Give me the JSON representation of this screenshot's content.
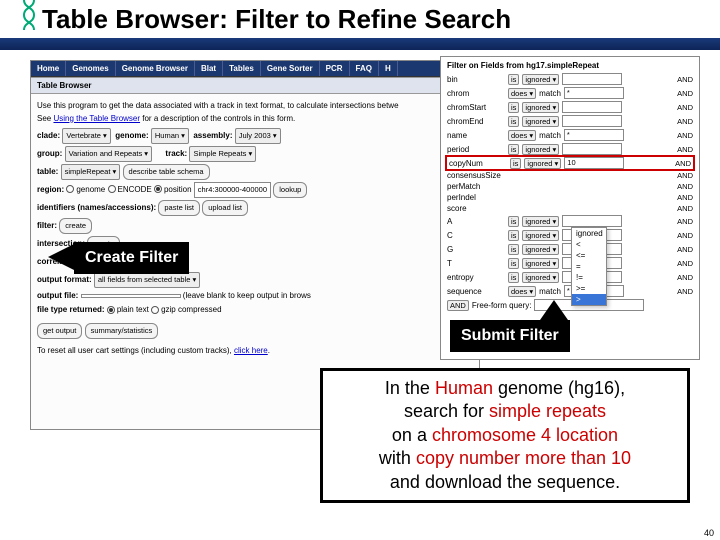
{
  "title": "Table Browser: Filter to Refine Search",
  "page_number": "40",
  "nav": [
    "Home",
    "Genomes",
    "Genome Browser",
    "Blat",
    "Tables",
    "Gene Sorter",
    "PCR",
    "FAQ",
    "H"
  ],
  "section_head": "Table Browser",
  "intro_line1": "Use this program to get the data associated with a track in text format, to calculate intersections betwe",
  "intro_link": "Using the Table Browser",
  "intro_line2": " for a description of the controls in this form.",
  "labels": {
    "clade": "clade:",
    "genome": "genome:",
    "assembly": "assembly:",
    "group": "group:",
    "track": "track:",
    "table": "table:",
    "describe": "describe table schema",
    "region": "region:",
    "identifiers": "identifiers (names/accessions):",
    "filter": "filter:",
    "intersection": "intersection:",
    "correlation": "correlation:",
    "output_format": "output format:",
    "output_file": "output file:",
    "output_file_hint": "(leave blank to keep output in brows",
    "file_type": "file type returned:",
    "reset": "To reset all user cart settings (including custom tracks), ",
    "click_here": "click here"
  },
  "values": {
    "clade": "Vertebrate ▾",
    "genome_val": "Human ▾",
    "assembly_val": "July 2003 ▾",
    "group_val": "Variation and Repeats ▾",
    "track_val": "Simple Repeats ▾",
    "table_val": "simpleRepeat ▾",
    "region_genome": "genome",
    "region_encode": "ENCODE",
    "region_position": "position",
    "position_val": "chr4:300000-400000",
    "lookup": "lookup",
    "paste": "paste list",
    "upload": "upload list",
    "create": "create",
    "output_fmt": "all fields from selected table ▾",
    "plain": "plain text",
    "gzip": "gzip compressed",
    "get_output": "get output",
    "summary": "summary/statistics"
  },
  "filter": {
    "title": "Filter on Fields from hg17.simpleRepeat",
    "does": "does ▾",
    "ignored": "ignored ▾",
    "match": "match",
    "and": "AND",
    "star": "*",
    "free_form": "Free-form query:",
    "copynum_value": "10",
    "rows": [
      "bin",
      "chrom",
      "chromStart",
      "chromEnd",
      "name",
      "period",
      "copyNum",
      "consensusSize",
      "perMatch",
      "perIndel",
      "score",
      "A",
      "C",
      "G",
      "T",
      "entropy",
      "sequence"
    ],
    "dropdown": [
      "ignored",
      "<",
      "<=",
      "=",
      "!=",
      ">=",
      ">"
    ],
    "dropdown_selected": ">"
  },
  "callouts": {
    "create_filter": "Create Filter",
    "submit_filter": "Submit Filter"
  },
  "mainbox": {
    "l1a": "In the ",
    "l1b": "Human",
    "l1c": " genome (hg16),",
    "l2a": "search for ",
    "l2b": "simple repeats",
    "l3a": "on a ",
    "l3b": "chromosome 4 location",
    "l4a": "with ",
    "l4b": "copy number more than 10",
    "l5": "and download the sequence."
  }
}
